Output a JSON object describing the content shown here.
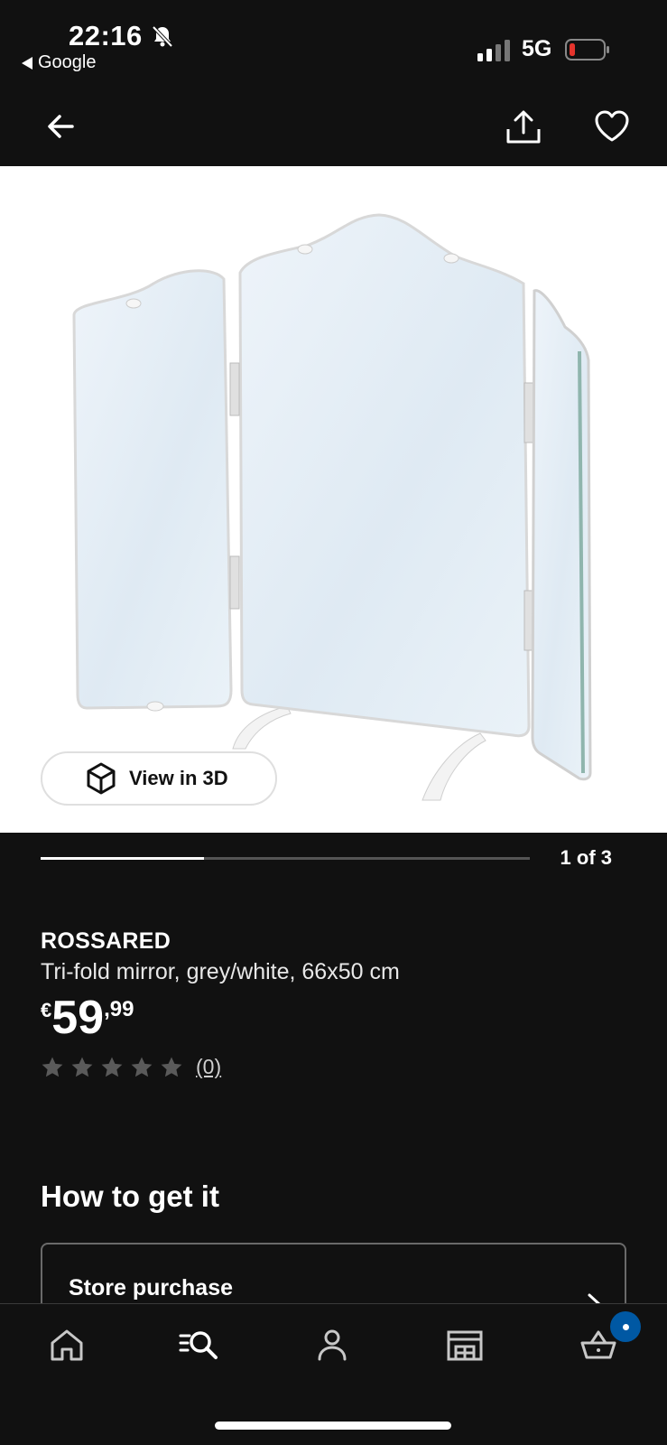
{
  "status_bar": {
    "time": "22:16",
    "back_app": "Google",
    "network": "5G"
  },
  "icons": {
    "back": "arrow-left-icon",
    "share": "share-icon",
    "favourite": "heart-icon",
    "view3d": "cube-icon",
    "bottom_nav": [
      "home-icon",
      "search-icon",
      "profile-icon",
      "store-icon",
      "cart-icon"
    ]
  },
  "gallery": {
    "view3d_label": "View in 3D",
    "pager": "1 of 3",
    "current": 1,
    "total": 3
  },
  "product": {
    "brand": "ROSSARED",
    "description": "Tri-fold mirror, grey/white, 66x50 cm",
    "price": {
      "currency": "€",
      "integer": "59",
      "decimal": ",99"
    },
    "rating": {
      "stars": 0,
      "max_stars": 5,
      "count_label": "(0)"
    }
  },
  "how_to_get_it": {
    "title": "How to get it",
    "store_purchase": "Store purchase"
  },
  "colors": {
    "background": "#111111",
    "accent_blue": "#0058a3",
    "battery_low": "#e5342c"
  }
}
